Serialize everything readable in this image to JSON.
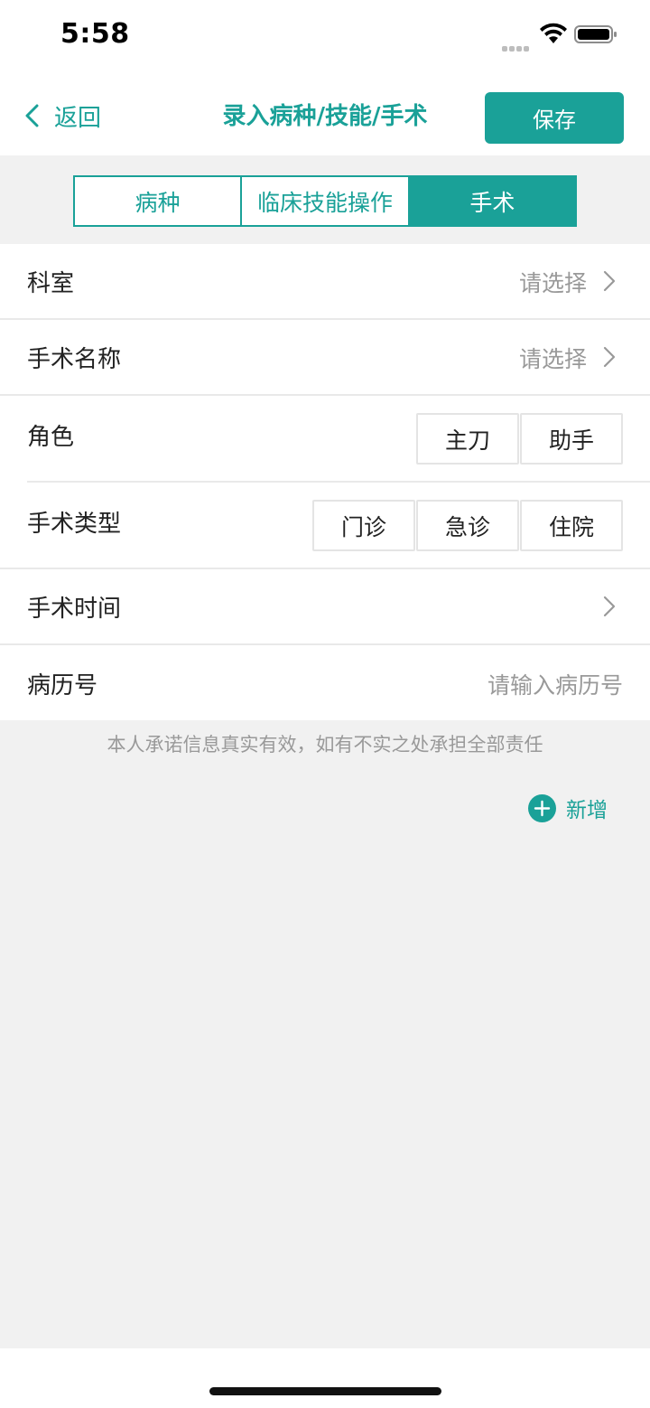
{
  "status_bar": {
    "time": "5:58"
  },
  "nav": {
    "back_label": "返回",
    "title": "录入病种/技能/手术",
    "save_label": "保存"
  },
  "tabs": [
    {
      "label": "病种",
      "active": false
    },
    {
      "label": "临床技能操作",
      "active": false
    },
    {
      "label": "手术",
      "active": true
    }
  ],
  "form": {
    "department": {
      "label": "科室",
      "placeholder": "请选择"
    },
    "surgery_name": {
      "label": "手术名称",
      "placeholder": "请选择"
    },
    "role": {
      "label": "角色",
      "options": [
        "主刀",
        "助手"
      ]
    },
    "surgery_type": {
      "label": "手术类型",
      "options": [
        "门诊",
        "急诊",
        "住院"
      ]
    },
    "surgery_time": {
      "label": "手术时间"
    },
    "record_no": {
      "label": "病历号",
      "placeholder": "请输入病历号"
    }
  },
  "notice": "本人承诺信息真实有效，如有不实之处承担全部责任",
  "add_label": "新增",
  "colors": {
    "accent": "#1aa198",
    "background": "#f1f1f1",
    "placeholder": "#999999"
  }
}
